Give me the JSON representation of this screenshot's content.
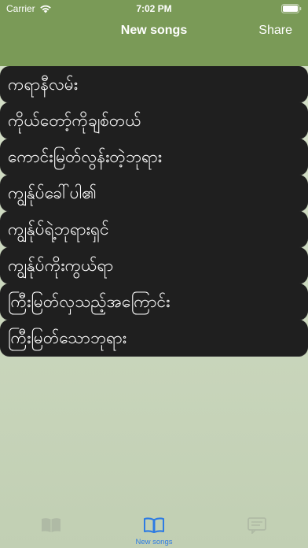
{
  "status_bar": {
    "carrier": "Carrier",
    "time": "7:02 PM"
  },
  "nav": {
    "title": "New songs",
    "share_label": "Share"
  },
  "songs": [
    "ကရာနီလမ်း",
    "ကိုယ်တော့်ကိုချစ်တယ်",
    "ကောင်းမြတ်လွန်းတဲ့ဘုရား",
    "ကျွန်ုပ်ခေါ်ပါ၏",
    "ကျွန်ုပ်ရဲ့ဘုရားရှင်",
    "ကျွန်ုပ်ကိုးကွယ်ရာ",
    "ကြီးမြတ်လှသည့်အကြောင်း",
    "ကြီးမြတ်သောဘုရား"
  ],
  "tabs": [
    {
      "label": "",
      "icon": "book-icon",
      "active": false
    },
    {
      "label": "New songs",
      "icon": "open-book-icon",
      "active": true
    },
    {
      "label": "",
      "icon": "message-icon",
      "active": false
    }
  ],
  "colors": {
    "header": "#7a9a57",
    "row_background": "#1f1f1f",
    "row_text": "#ffffff",
    "tab_active": "#2d7be3",
    "page_background": "#cdd9c0"
  }
}
